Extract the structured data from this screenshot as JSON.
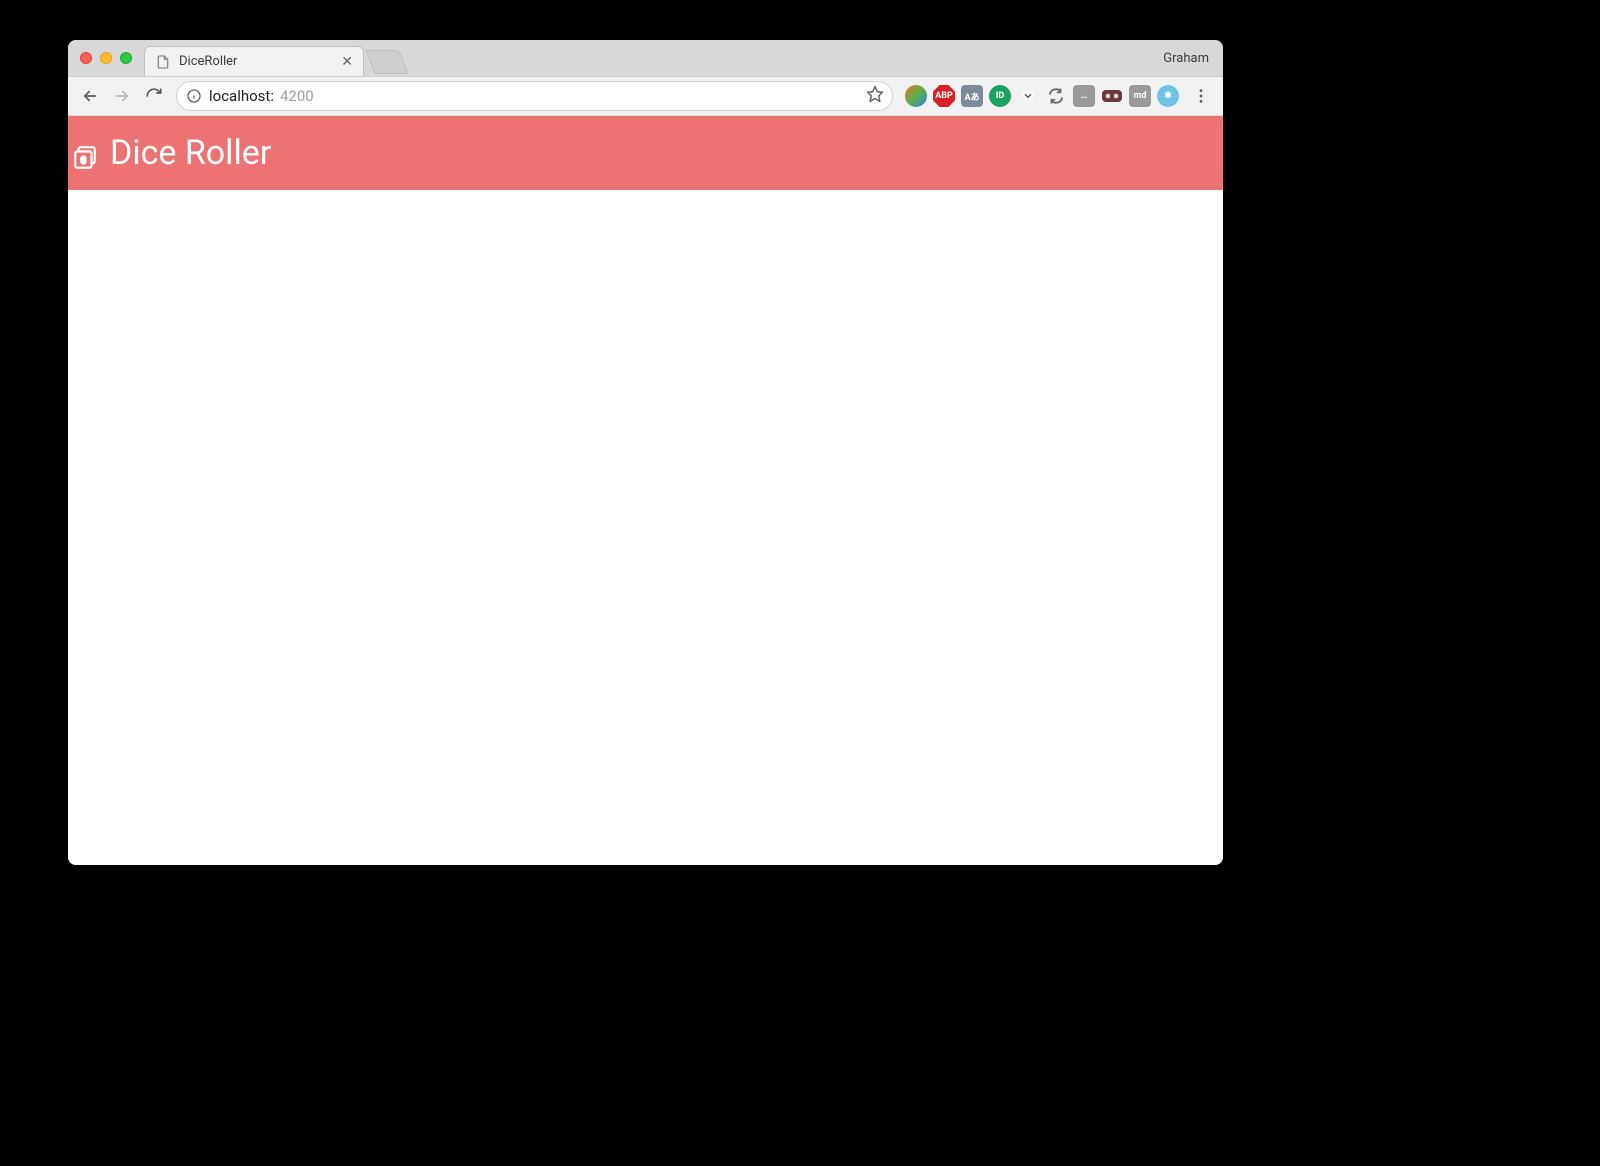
{
  "browser": {
    "profile_name": "Graham",
    "tab_title": "DiceRoller",
    "url_host": "localhost:",
    "url_port": "4200"
  },
  "extensions": [
    {
      "name": "ext-1",
      "bg": "linear-gradient(135deg,#ec6e2b,#58b14a,#3b7de0)",
      "label": ""
    },
    {
      "name": "abp-icon",
      "bg": "#d62027",
      "label": "ABP",
      "shape": "octagon"
    },
    {
      "name": "translate-icon",
      "bg": "#7d8a97",
      "label": "Aあ",
      "shape": "square"
    },
    {
      "name": "green-circle-icon",
      "bg": "#1aa260",
      "label": "ID"
    },
    {
      "name": "pocket-icon",
      "bg": "#444",
      "label": "",
      "shape": "pocket"
    },
    {
      "name": "refresh-ext-icon",
      "bg": "#6b6b6b",
      "label": "",
      "shape": "loop"
    },
    {
      "name": "chat-ext-icon",
      "bg": "#9a9a9a",
      "label": "…",
      "shape": "square"
    },
    {
      "name": "mask-ext-icon",
      "bg": "#6a3a3a",
      "label": "",
      "shape": "mask"
    },
    {
      "name": "md-ext-icon",
      "bg": "#9a9a9a",
      "label": "md",
      "shape": "square"
    },
    {
      "name": "snowflake-ext-icon",
      "bg": "#6fc3e4",
      "label": "✱"
    }
  ],
  "app": {
    "title": "Dice Roller"
  }
}
